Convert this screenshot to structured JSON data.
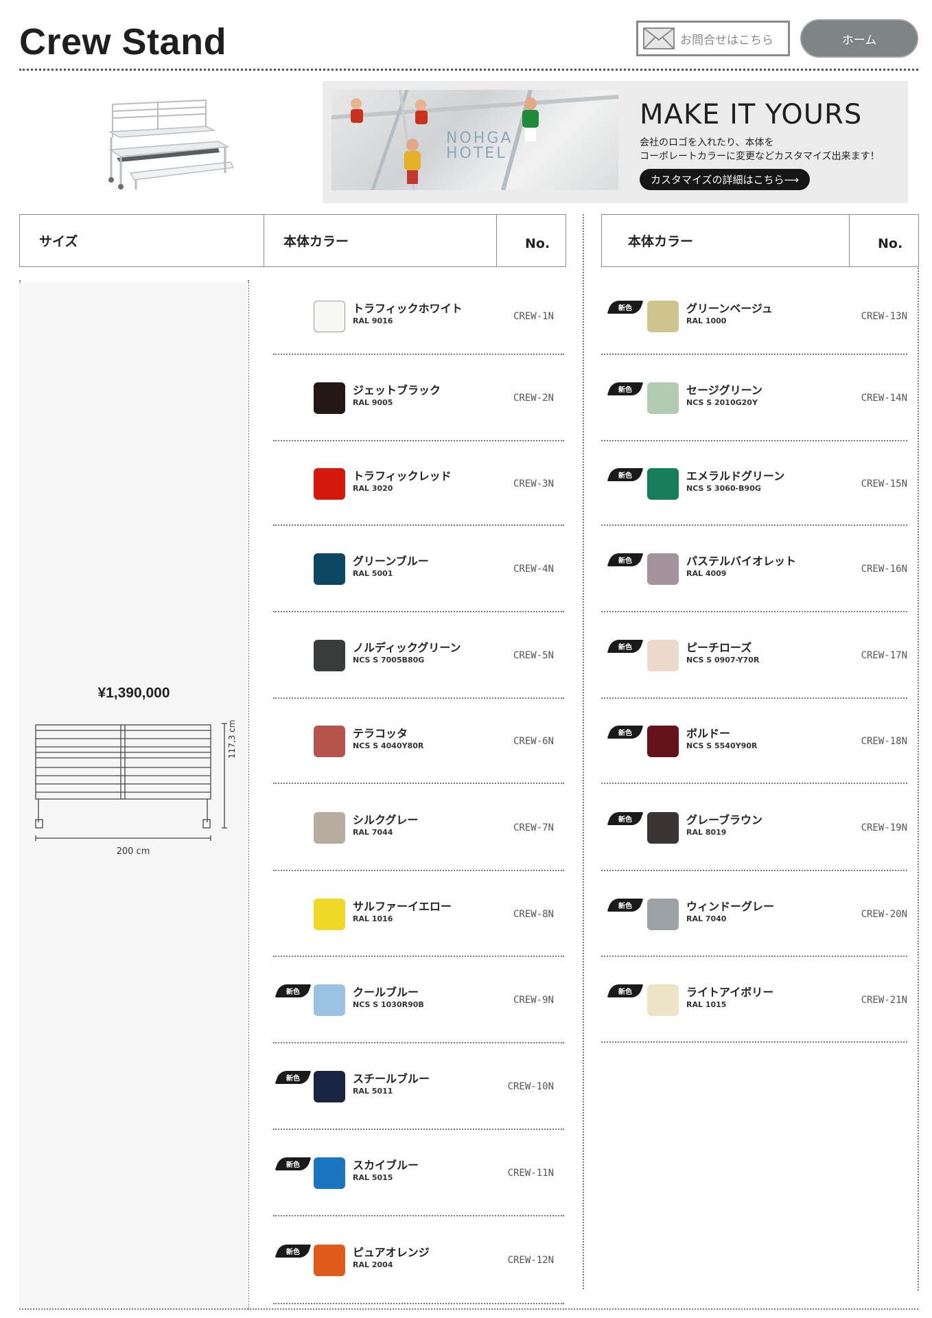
{
  "header": {
    "title": "Crew Stand",
    "contact_label": "お問合せはこちら",
    "home_label": "ホーム"
  },
  "banner": {
    "photo_text_1": "NOHGA",
    "photo_text_2": "HOTEL",
    "title": "MAKE IT YOURS",
    "desc_line_1": "会社のロゴを入れたり、本体を",
    "desc_line_2": "コーポレートカラーに変更などカスタマイズ出来ます！",
    "cta": "カスタマイズの詳細はこちら⟶"
  },
  "table": {
    "size_header": "サイズ",
    "color_header": "本体カラー",
    "no_header": "No.",
    "price": "¥1,390,000",
    "height_dim": "117,3 cm",
    "width_dim": "200 cm",
    "new_badge": "新色"
  },
  "colors_left": [
    {
      "name": "トラフィックホワイト",
      "code": "RAL 9016",
      "no": "CREW-1N",
      "hex": "#f7f7f5",
      "new": false
    },
    {
      "name": "ジェットブラック",
      "code": "RAL 9005",
      "no": "CREW-2N",
      "hex": "#231816",
      "new": false
    },
    {
      "name": "トラフィックレッド",
      "code": "RAL 3020",
      "no": "CREW-3N",
      "hex": "#d4180d",
      "new": false
    },
    {
      "name": "グリーンブルー",
      "code": "RAL 5001",
      "no": "CREW-4N",
      "hex": "#0c4660",
      "new": false
    },
    {
      "name": "ノルディックグリーン",
      "code": "NCS S 7005B80G",
      "no": "CREW-5N",
      "hex": "#383d3b",
      "new": false
    },
    {
      "name": "テラコッタ",
      "code": "NCS S 4040Y80R",
      "no": "CREW-6N",
      "hex": "#b5544a",
      "new": false
    },
    {
      "name": "シルクグレー",
      "code": "RAL 7044",
      "no": "CREW-7N",
      "hex": "#b6ada1",
      "new": false
    },
    {
      "name": "サルファーイエロー",
      "code": "RAL 1016",
      "no": "CREW-8N",
      "hex": "#edd926",
      "new": false
    },
    {
      "name": "クールブルー",
      "code": "NCS S 1030R90B",
      "no": "CREW-9N",
      "hex": "#9bc2e2",
      "new": true
    },
    {
      "name": "スチールブルー",
      "code": "RAL 5011",
      "no": "CREW-10N",
      "hex": "#1a2443",
      "new": true
    },
    {
      "name": "スカイブルー",
      "code": "RAL 5015",
      "no": "CREW-11N",
      "hex": "#1a75be",
      "new": true
    },
    {
      "name": "ピュアオレンジ",
      "code": "RAL 2004",
      "no": "CREW-12N",
      "hex": "#e05a1c",
      "new": true
    }
  ],
  "colors_right": [
    {
      "name": "グリーンベージュ",
      "code": "RAL 1000",
      "no": "CREW-13N",
      "hex": "#cdc58d",
      "new": true
    },
    {
      "name": "セージグリーン",
      "code": "NCS S 2010G20Y",
      "no": "CREW-14N",
      "hex": "#b2cbb3",
      "new": true
    },
    {
      "name": "エメラルドグリーン",
      "code": "NCS S 3060-B90G",
      "no": "CREW-15N",
      "hex": "#177c5a",
      "new": true
    },
    {
      "name": "パステルバイオレット",
      "code": "RAL 4009",
      "no": "CREW-16N",
      "hex": "#a4939c",
      "new": true
    },
    {
      "name": "ピーチローズ",
      "code": "NCS S 0907-Y70R",
      "no": "CREW-17N",
      "hex": "#ecd9cb",
      "new": true
    },
    {
      "name": "ボルドー",
      "code": "NCS S 5540Y90R",
      "no": "CREW-18N",
      "hex": "#66121a",
      "new": true
    },
    {
      "name": "グレーブラウン",
      "code": "RAL 8019",
      "no": "CREW-19N",
      "hex": "#3b3435",
      "new": true
    },
    {
      "name": "ウィンドーグレー",
      "code": "RAL 7040",
      "no": "CREW-20N",
      "hex": "#9ca2a5",
      "new": true
    },
    {
      "name": "ライトアイボリー",
      "code": "RAL 1015",
      "no": "CREW-21N",
      "hex": "#ede4c6",
      "new": true
    }
  ]
}
